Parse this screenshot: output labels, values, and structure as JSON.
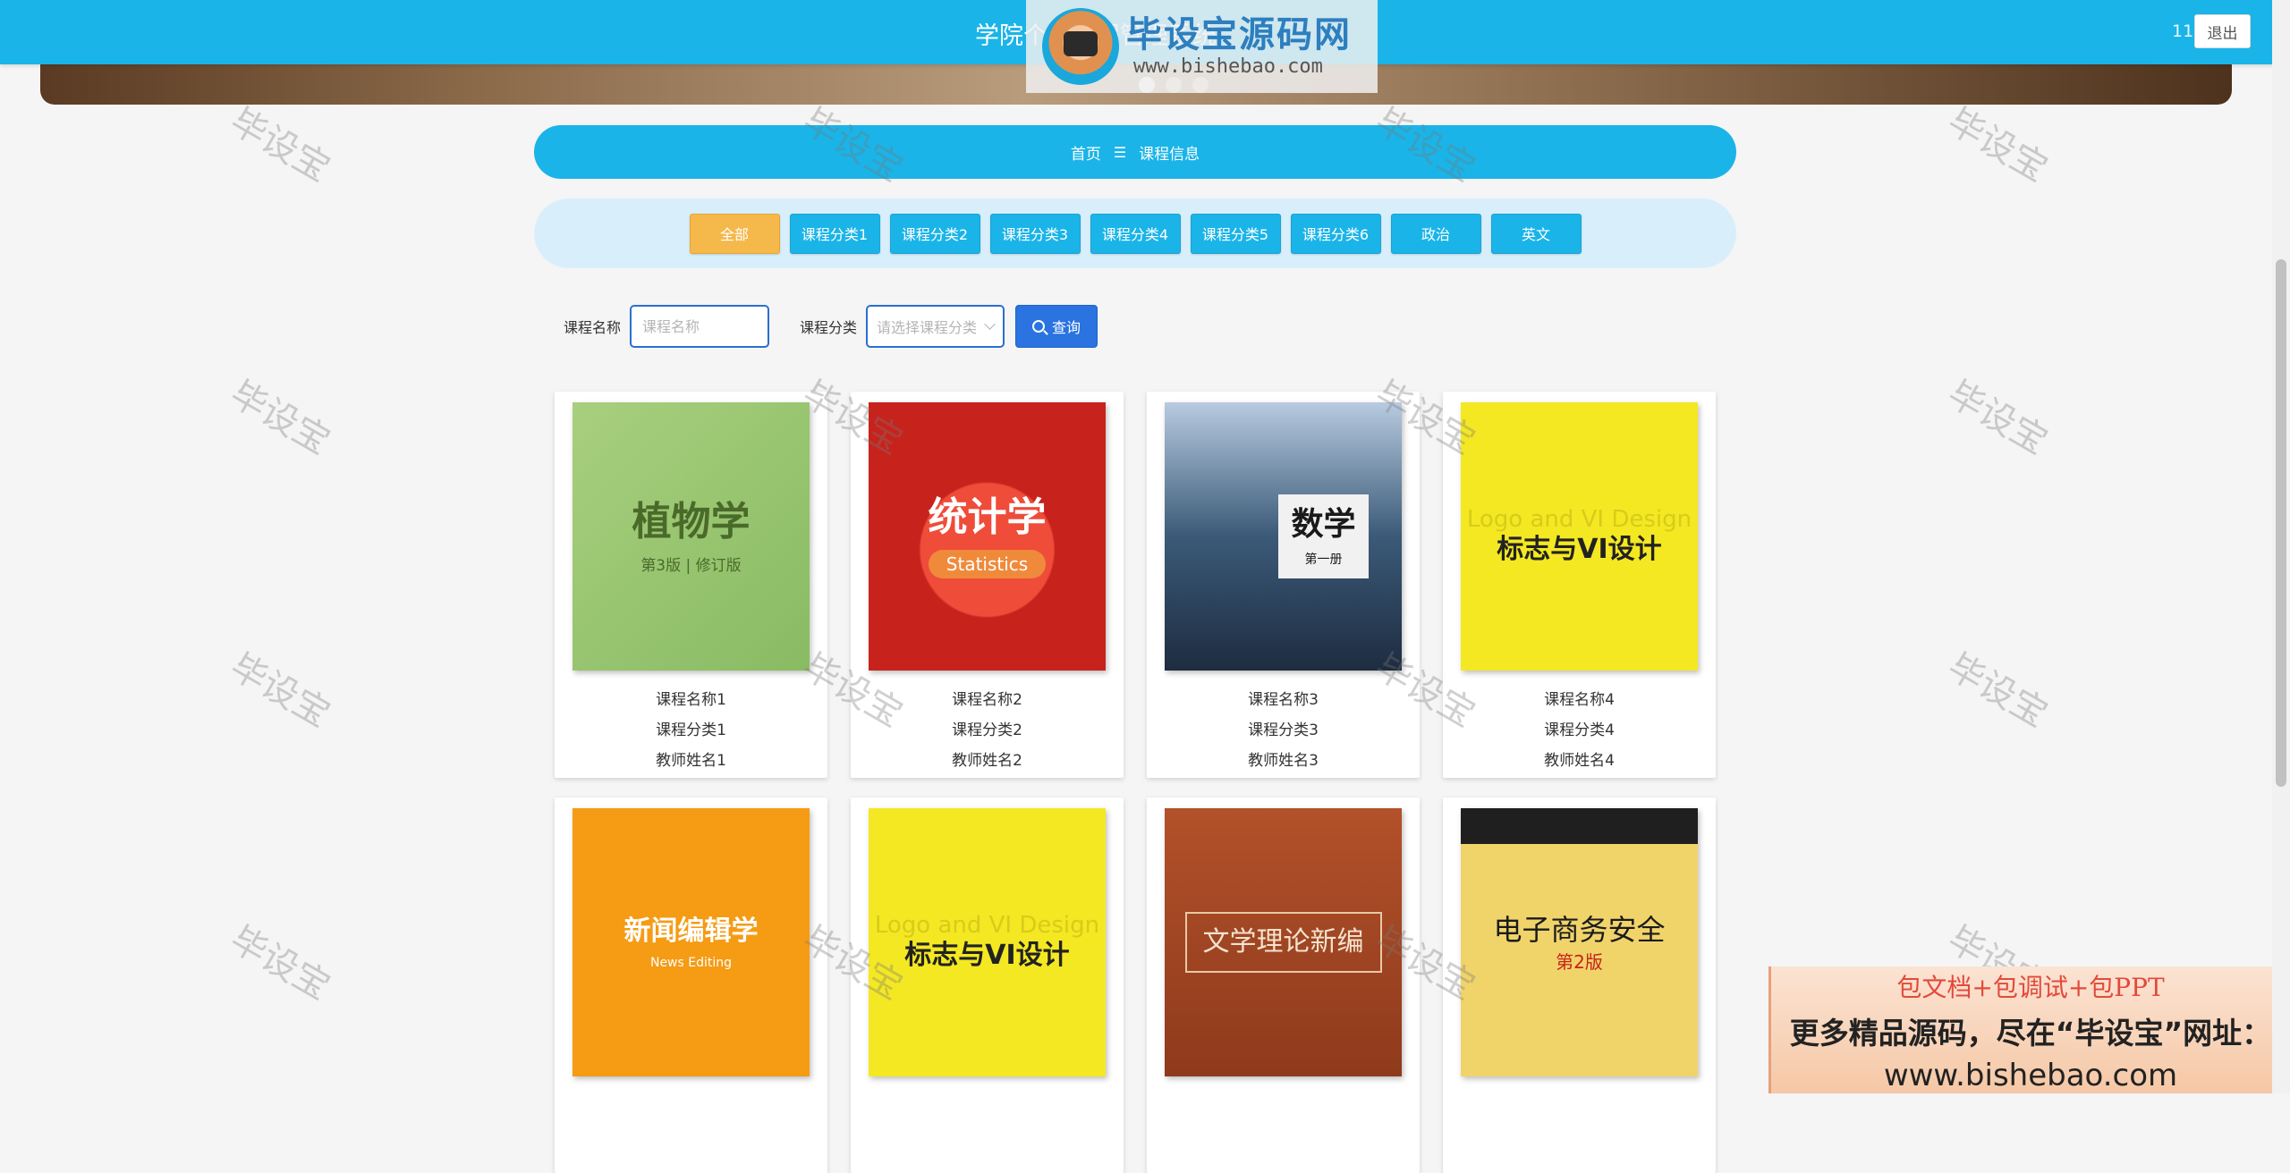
{
  "header": {
    "site_title": "学院个人课程管理系统",
    "user_name": "11",
    "logout_label": "退出"
  },
  "watermark": {
    "brand": "毕设宝源码网",
    "url": "www.bishebao.com",
    "repeat_text": "毕设宝"
  },
  "breadcrumb": {
    "home": "首页",
    "separator": "☰",
    "current": "课程信息"
  },
  "categories": [
    {
      "label": "全部",
      "active": true
    },
    {
      "label": "课程分类1",
      "active": false
    },
    {
      "label": "课程分类2",
      "active": false
    },
    {
      "label": "课程分类3",
      "active": false
    },
    {
      "label": "课程分类4",
      "active": false
    },
    {
      "label": "课程分类5",
      "active": false
    },
    {
      "label": "课程分类6",
      "active": false
    },
    {
      "label": "政治",
      "active": false
    },
    {
      "label": "英文",
      "active": false
    }
  ],
  "search": {
    "name_label": "课程名称",
    "name_placeholder": "课程名称",
    "category_label": "课程分类",
    "category_placeholder": "请选择课程分类",
    "query_label": "查询"
  },
  "courses": [
    {
      "name": "课程名称1",
      "category": "课程分类1",
      "teacher": "教师姓名1",
      "cover_title": "植物学",
      "cover_sub": "第3版 | 修订版"
    },
    {
      "name": "课程名称2",
      "category": "课程分类2",
      "teacher": "教师姓名2",
      "cover_title": "统计学",
      "cover_sub": "Statistics"
    },
    {
      "name": "课程名称3",
      "category": "课程分类3",
      "teacher": "教师姓名3",
      "cover_title": "数学",
      "cover_sub": "第一册"
    },
    {
      "name": "课程名称4",
      "category": "课程分类4",
      "teacher": "教师姓名4",
      "cover_title": "标志与VI设计",
      "cover_sub": "Logo and VI Design"
    },
    {
      "cover_title": "新闻编辑学",
      "cover_sub": "News Editing"
    },
    {
      "cover_title": "标志与VI设计",
      "cover_sub": "Logo and VI Design"
    },
    {
      "cover_title": "文学理论新编"
    },
    {
      "cover_title": "电子商务安全",
      "cover_sub": "第2版"
    }
  ],
  "ad": {
    "line1": "包文档+包调试+包PPT",
    "line2": "更多精品源码，尽在“毕设宝”网址：",
    "line3": "www.bishebao.com"
  },
  "colors": {
    "primary": "#1ab4e8",
    "active_tab": "#f5b84a",
    "query_button": "#2a73e0"
  }
}
